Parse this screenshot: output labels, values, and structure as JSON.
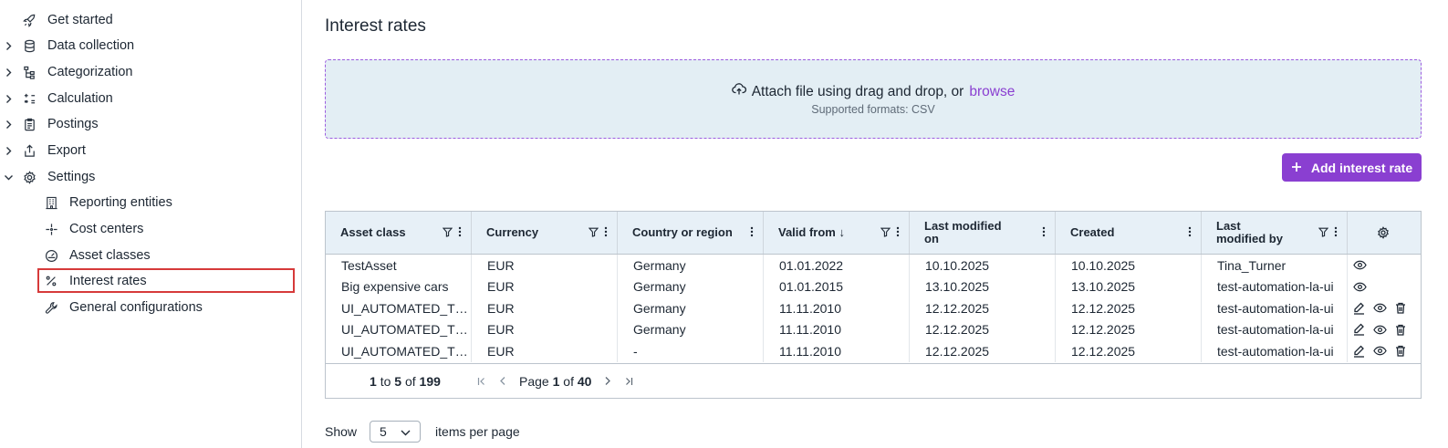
{
  "sidebar": {
    "items": [
      {
        "label": "Get started",
        "icon": "rocket-icon",
        "expandable": false
      },
      {
        "label": "Data collection",
        "icon": "database-icon",
        "expandable": true
      },
      {
        "label": "Categorization",
        "icon": "hierarchy-icon",
        "expandable": true
      },
      {
        "label": "Calculation",
        "icon": "calculator-icon",
        "expandable": true
      },
      {
        "label": "Postings",
        "icon": "clipboard-icon",
        "expandable": true
      },
      {
        "label": "Export",
        "icon": "export-icon",
        "expandable": true
      },
      {
        "label": "Settings",
        "icon": "gear-icon",
        "expandable": true,
        "expanded": true
      }
    ],
    "sub_items": [
      {
        "label": "Reporting entities",
        "icon": "building-icon"
      },
      {
        "label": "Cost centers",
        "icon": "sparkle-icon"
      },
      {
        "label": "Asset classes",
        "icon": "gauge-icon"
      },
      {
        "label": "Interest rates",
        "icon": "percent-icon",
        "active": true
      },
      {
        "label": "General configurations",
        "icon": "wrench-icon"
      }
    ]
  },
  "page": {
    "title": "Interest rates"
  },
  "dropzone": {
    "text": "Attach file using drag and drop, or",
    "browse": "browse",
    "formats": "Supported formats: CSV"
  },
  "add_button": {
    "label": "Add interest rate"
  },
  "table": {
    "columns": [
      {
        "label": "Asset class",
        "filter": true,
        "sort": ""
      },
      {
        "label": "Currency",
        "filter": true,
        "sort": ""
      },
      {
        "label": "Country or region",
        "filter": false,
        "sort": ""
      },
      {
        "label": "Valid from",
        "filter": true,
        "sort": "↓"
      },
      {
        "label": "Last modified on",
        "filter": false,
        "sort": ""
      },
      {
        "label": "Created",
        "filter": false,
        "sort": ""
      },
      {
        "label": "Last modified by",
        "filter": true,
        "sort": ""
      }
    ],
    "rows": [
      [
        "TestAsset",
        "EUR",
        "Germany",
        "01.01.2022",
        "10.10.2025",
        "10.10.2025",
        "Tina_Turner"
      ],
      [
        "Big expensive cars",
        "EUR",
        "Germany",
        "01.01.2015",
        "13.10.2025",
        "13.10.2025",
        "test-automation-la-ui"
      ],
      [
        "UI_AUTOMATED_T…",
        "EUR",
        "Germany",
        "11.11.2010",
        "12.12.2025",
        "12.12.2025",
        "test-automation-la-ui"
      ],
      [
        "UI_AUTOMATED_T…",
        "EUR",
        "Germany",
        "11.11.2010",
        "12.12.2025",
        "12.12.2025",
        "test-automation-la-ui"
      ],
      [
        "UI_AUTOMATED_T…",
        "EUR",
        "-",
        "11.11.2010",
        "12.12.2025",
        "12.12.2025",
        "test-automation-la-ui"
      ]
    ],
    "row_actions": [
      [
        "eye-icon"
      ],
      [
        "eye-icon"
      ],
      [
        "edit-icon",
        "eye-icon",
        "trash-icon"
      ],
      [
        "edit-icon",
        "eye-icon",
        "trash-icon"
      ],
      [
        "edit-icon",
        "eye-icon",
        "trash-icon"
      ]
    ]
  },
  "pager": {
    "from": "1",
    "to_word": "to",
    "to": "5",
    "of_word": "of",
    "total": "199",
    "page_word": "Page",
    "page": "1",
    "pages": "40"
  },
  "page_size": {
    "show_label": "Show",
    "value": "5",
    "suffix": "items per page"
  },
  "colors": {
    "accent": "#8a3fd1",
    "header_bg": "#e7f0f7",
    "dropzone_bg": "#e3eef4",
    "highlight_border": "#d63a3a"
  }
}
